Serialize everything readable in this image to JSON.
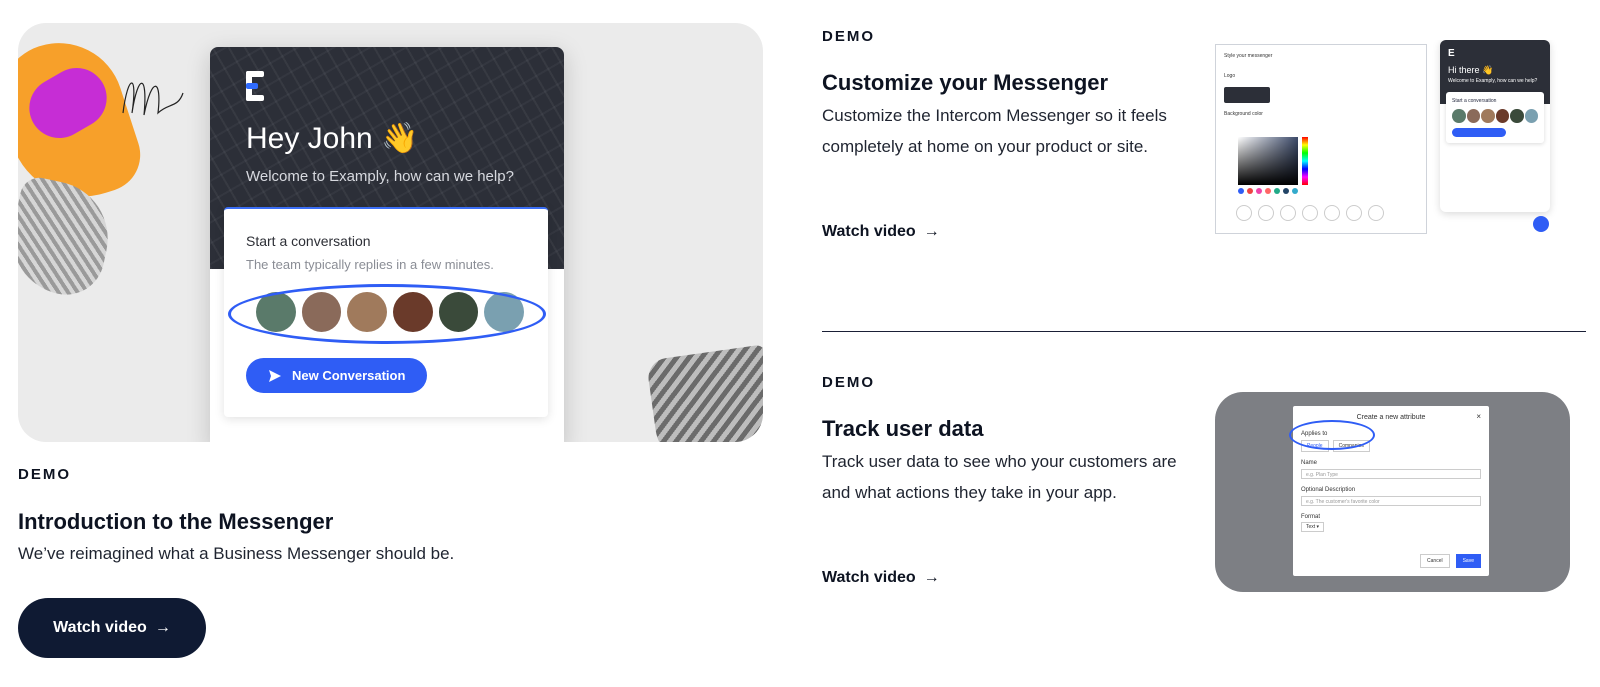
{
  "left": {
    "tag": "DEMO",
    "title": "Introduction to the Messenger",
    "description": "We’ve reimagined what a Business Messenger should be.",
    "button": "Watch video",
    "arrow": "→",
    "messenger": {
      "greeting": "Hey John 👋",
      "subtitle": "Welcome to Examply, how can we help?",
      "card_title": "Start a conversation",
      "card_sub": "The team typically replies in a few minutes.",
      "new_conversation": "New Conversation",
      "avatar_colors": [
        "#5a7a6a",
        "#8a6a5a",
        "#a07a5c",
        "#6a3a2a",
        "#3a4a3a",
        "#7aa0b0"
      ]
    }
  },
  "items": [
    {
      "tag": "DEMO",
      "title": "Customize your Messenger",
      "description": "Customize the Intercom Messenger so it feels completely at home on your product or site.",
      "link": "Watch video",
      "arrow": "→",
      "preview": {
        "panel_title": "Style your messenger",
        "logo_label": "Logo",
        "bg_label": "Background color",
        "mini_greeting": "Hi there 👋",
        "mini_sub": "Welcome to Examply, how can we help?",
        "mini_card": "Start a conversation"
      }
    },
    {
      "tag": "DEMO",
      "title": "Track user data",
      "description": "Track user data to see who your customers are and what actions they take in your app.",
      "link": "Watch video",
      "arrow": "→",
      "preview": {
        "modal_title": "Create a new attribute",
        "applies_to": "Applies to",
        "tab_people": "People",
        "tab_companies": "Companies",
        "name_label": "Name",
        "name_placeholder": "e.g. Plan Type",
        "desc_label": "Optional Description",
        "desc_placeholder": "e.g. The customer's favorite color",
        "format_label": "Format",
        "format_value": "Text ▾",
        "cancel": "Cancel",
        "save": "Save"
      }
    }
  ],
  "colors": {
    "navy": "#0f1a33",
    "accent": "#2f5df5",
    "orange": "#f7a02a",
    "purple": "#c020e8"
  }
}
